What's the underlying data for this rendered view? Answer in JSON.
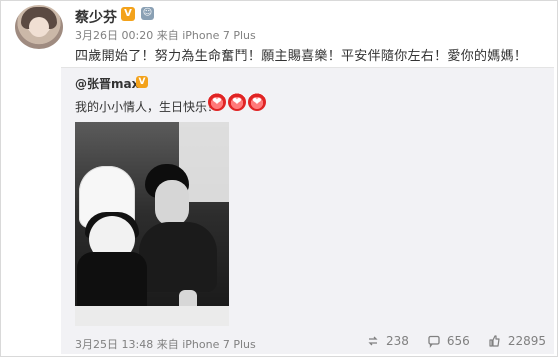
{
  "post": {
    "author_name": "蔡少芬",
    "author_badge": "V",
    "timestamp": "3月26日 00:20",
    "source_prefix": "来自",
    "source": "iPhone 7 Plus",
    "text": "四歲開始了！努力為生命奮鬥！願主賜喜樂！平安伴隨你左右！愛你的媽媽！"
  },
  "repost": {
    "author_name": "@张晋max",
    "author_badge": "V",
    "text": "我的小小情人，生日快乐！",
    "timestamp": "3月25日 13:48",
    "source_prefix": "来自",
    "source": "iPhone 7 Plus",
    "stats": {
      "reposts": "238",
      "comments": "656",
      "likes": "22895"
    }
  },
  "icons": {
    "verified": "verified-badge-icon",
    "robot": "weibo-robot-icon",
    "heart_emoji": "heart-emoji-icon",
    "repost": "repost-icon",
    "comment": "comment-icon",
    "like": "like-icon"
  },
  "colors": {
    "repost_bg": "#f2f2f5",
    "meta_text": "#808080",
    "badge_orange": "#f3a21b",
    "heart_red": "#e02424"
  }
}
